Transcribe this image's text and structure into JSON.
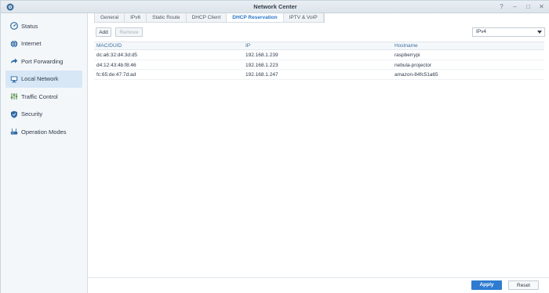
{
  "window": {
    "title": "Network Center",
    "controls": [
      "?",
      "–",
      "□",
      "✕"
    ]
  },
  "sidebar": {
    "items": [
      {
        "label": "Status",
        "icon": "status-gauge-icon"
      },
      {
        "label": "Internet",
        "icon": "globe-icon"
      },
      {
        "label": "Port Forwarding",
        "icon": "arrow-forward-icon"
      },
      {
        "label": "Local Network",
        "icon": "local-network-icon",
        "active": true
      },
      {
        "label": "Traffic Control",
        "icon": "sliders-icon"
      },
      {
        "label": "Security",
        "icon": "shield-icon"
      },
      {
        "label": "Operation Modes",
        "icon": "router-icon"
      }
    ]
  },
  "tabs": [
    "General",
    "IPv6",
    "Static Route",
    "DHCP Client",
    "DHCP Reservation",
    "IPTV & VoIP"
  ],
  "active_tab": "DHCP Reservation",
  "toolbar": {
    "add_label": "Add",
    "remove_label": "Remove",
    "ip_version_selected": "IPv4"
  },
  "table": {
    "columns": [
      "MAC/DUID",
      "IP",
      "Hostname"
    ],
    "rows": [
      [
        "dc:a6:32:d4:3d:d5",
        "192.168.1.239",
        "raspberrypi"
      ],
      [
        "d4:12:43:4b:f8:46",
        "192.168.1.223",
        "nebula-projector"
      ],
      [
        "fc:65:de:47:7d:ad",
        "192.168.1.247",
        "amazon-84fc51a65"
      ]
    ]
  },
  "footer": {
    "apply_label": "Apply",
    "reset_label": "Reset"
  },
  "colors": {
    "accent": "#2e7bd1",
    "active_tab_text": "#2a77c9",
    "sidebar_active_bg": "#d8e7f6"
  }
}
